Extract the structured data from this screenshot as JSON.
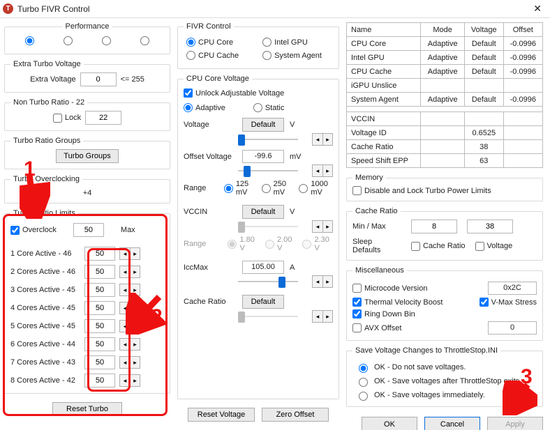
{
  "window": {
    "title": "Turbo FIVR Control",
    "icon_letter": "T"
  },
  "performance": {
    "legend": "Performance",
    "selected_index": 0
  },
  "extra_turbo": {
    "legend": "Extra Turbo Voltage",
    "label": "Extra Voltage",
    "value": "0",
    "limit": "<= 255"
  },
  "non_turbo": {
    "legend": "Non Turbo Ratio - 22",
    "lock_label": "Lock",
    "value": "22"
  },
  "turbo_groups": {
    "legend": "Turbo Ratio Groups",
    "button": "Turbo Groups"
  },
  "overclocking": {
    "legend": "Turbo Overclocking",
    "delta": "+4"
  },
  "turbo_limits": {
    "legend": "Turbo Ratio Limits",
    "overclock_label": "Overclock",
    "max_value": "50",
    "max_label": "Max",
    "rows": [
      {
        "name": "1 Core  Active - 46",
        "val": "50"
      },
      {
        "name": "2 Cores Active - 46",
        "val": "50"
      },
      {
        "name": "3 Cores Active - 45",
        "val": "50"
      },
      {
        "name": "4 Cores Active - 45",
        "val": "50"
      },
      {
        "name": "5 Cores Active - 45",
        "val": "50"
      },
      {
        "name": "6 Cores Active - 44",
        "val": "50"
      },
      {
        "name": "7 Cores Active - 43",
        "val": "50"
      },
      {
        "name": "8 Cores Active - 42",
        "val": "50"
      }
    ]
  },
  "reset_turbo": "Reset Turbo",
  "fivr": {
    "legend": "FIVR Control",
    "cpu_core": "CPU Core",
    "intel_gpu": "Intel GPU",
    "cpu_cache": "CPU Cache",
    "system_agent": "System Agent"
  },
  "core_voltage": {
    "legend": "CPU Core Voltage",
    "unlock": "Unlock Adjustable Voltage",
    "adaptive": "Adaptive",
    "static": "Static",
    "voltage_lbl": "Voltage",
    "voltage_btn": "Default",
    "voltage_unit": "V",
    "offset_lbl": "Offset Voltage",
    "offset_val": "-99.6",
    "offset_unit": "mV",
    "range_lbl": "Range",
    "range_125": "125 mV",
    "range_250": "250 mV",
    "range_1000": "1000 mV",
    "vccin_lbl": "VCCIN",
    "vccin_btn": "Default",
    "vccin_unit": "V",
    "vrange_180": "1.80 V",
    "vrange_200": "2.00 V",
    "vrange_230": "2.30 V",
    "iccmax_lbl": "IccMax",
    "iccmax_val": "105.00",
    "iccmax_unit": "A",
    "cache_lbl": "Cache Ratio",
    "cache_btn": "Default",
    "reset_voltage": "Reset Voltage",
    "zero_offset": "Zero Offset"
  },
  "vtable": {
    "h_name": "Name",
    "h_mode": "Mode",
    "h_voltage": "Voltage",
    "h_offset": "Offset",
    "rows": [
      {
        "name": "CPU Core",
        "mode": "Adaptive",
        "voltage": "Default",
        "offset": "-0.0996"
      },
      {
        "name": "Intel GPU",
        "mode": "Adaptive",
        "voltage": "Default",
        "offset": "-0.0996"
      },
      {
        "name": "CPU Cache",
        "mode": "Adaptive",
        "voltage": "Default",
        "offset": "-0.0996"
      },
      {
        "name": "iGPU Unslice",
        "mode": "",
        "voltage": "",
        "offset": ""
      },
      {
        "name": "System Agent",
        "mode": "Adaptive",
        "voltage": "Default",
        "offset": "-0.0996"
      }
    ],
    "vccin_row": "VCCIN",
    "voltage_id": "Voltage ID",
    "voltage_id_val": "0.6525",
    "cache_ratio": "Cache Ratio",
    "cache_ratio_val": "38",
    "speed_shift": "Speed Shift EPP",
    "speed_shift_val": "63"
  },
  "memory": {
    "legend": "Memory",
    "disable_lock": "Disable and Lock Turbo Power Limits"
  },
  "cache_ratio": {
    "legend": "Cache Ratio",
    "minmax": "Min / Max",
    "min": "8",
    "max": "38",
    "sleep": "Sleep Defaults",
    "cache_cb": "Cache Ratio",
    "voltage_cb": "Voltage"
  },
  "misc": {
    "legend": "Miscellaneous",
    "microcode": "Microcode Version",
    "microcode_val": "0x2C",
    "tvb": "Thermal Velocity Boost",
    "vmax": "V-Max Stress",
    "ring": "Ring Down Bin",
    "avx": "AVX Offset",
    "avx_val": "0"
  },
  "save": {
    "legend": "Save Voltage Changes to ThrottleStop.INI",
    "opt1": "OK - Do not save voltages.",
    "opt2": "OK - Save voltages after ThrottleStop exits.",
    "opt3": "OK - Save voltages immediately."
  },
  "footer": {
    "ok": "OK",
    "cancel": "Cancel",
    "apply": "Apply"
  },
  "annotations": {
    "n1": "1",
    "n2": "2",
    "n3": "3"
  }
}
